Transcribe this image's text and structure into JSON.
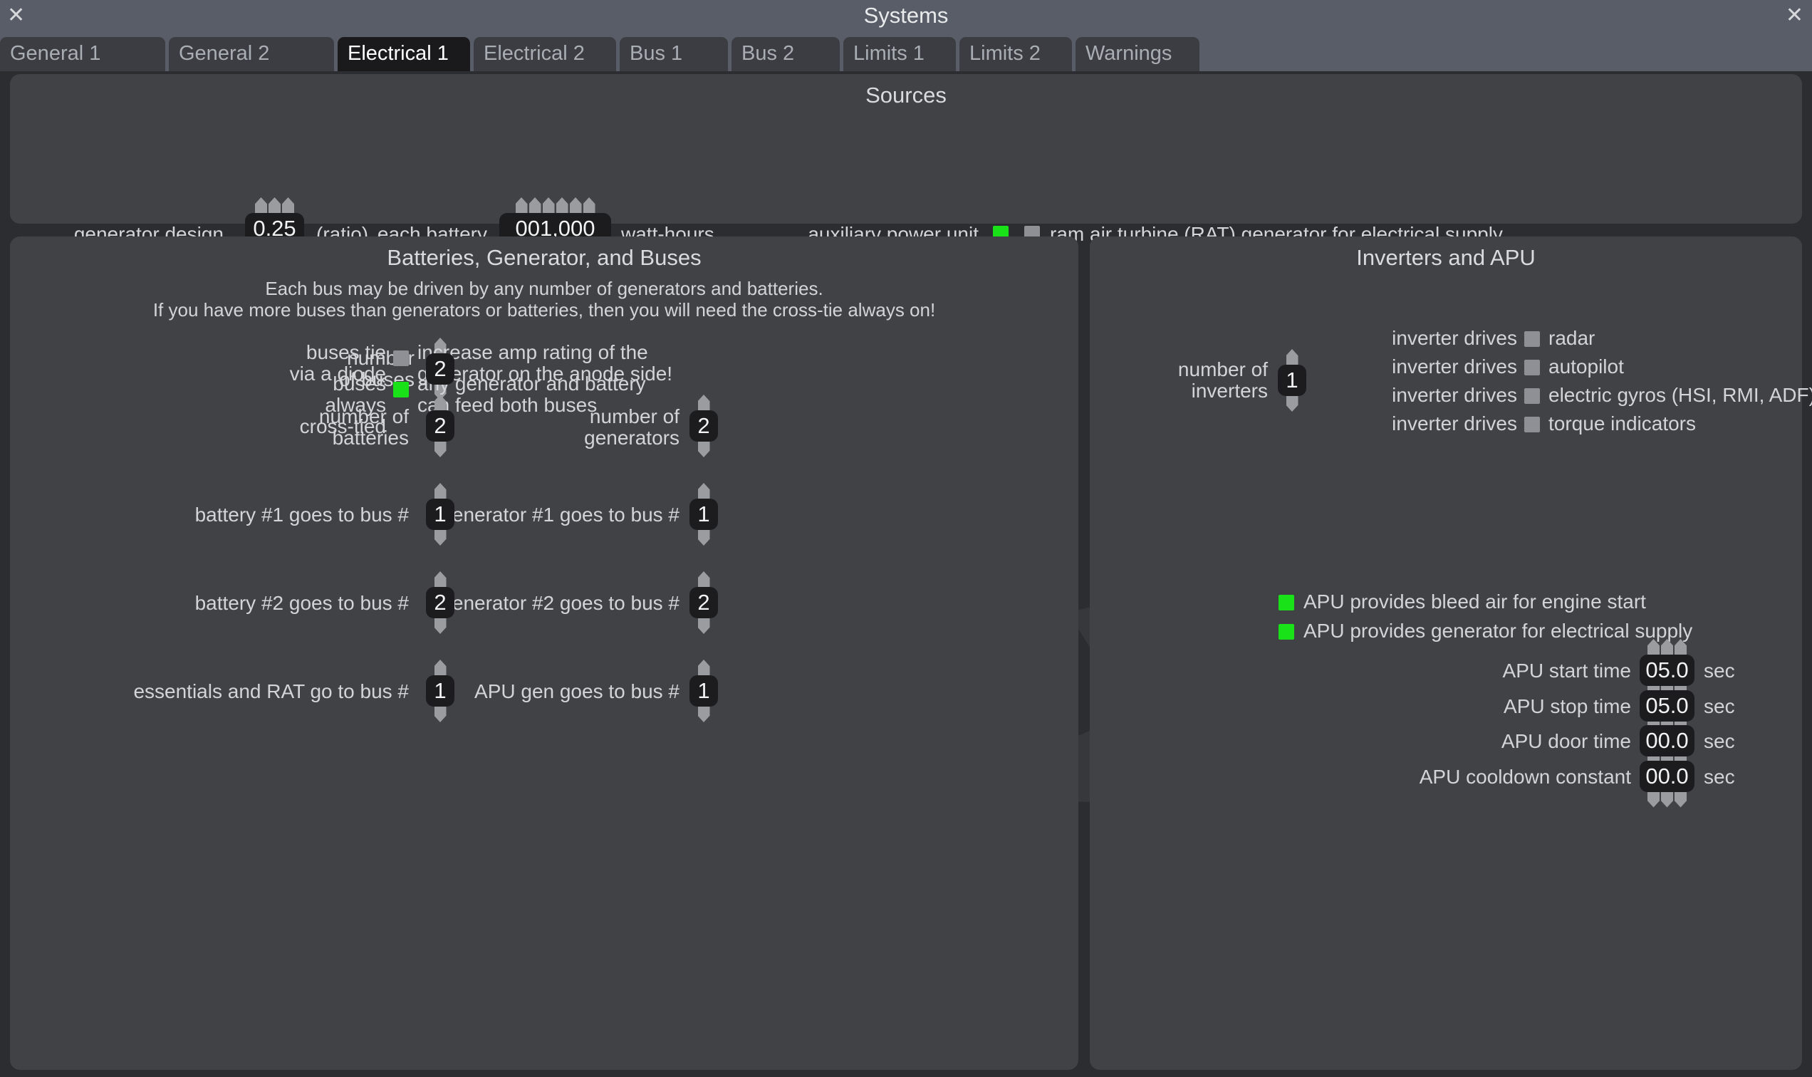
{
  "window": {
    "title": "Systems",
    "close_icon": "✕"
  },
  "tabs": [
    {
      "label": "General 1",
      "active": false
    },
    {
      "label": "General 2",
      "active": false
    },
    {
      "label": "Electrical 1",
      "active": true
    },
    {
      "label": "Electrical 2",
      "active": false
    },
    {
      "label": "Bus 1",
      "active": false
    },
    {
      "label": "Bus 2",
      "active": false
    },
    {
      "label": "Limits 1",
      "active": false
    },
    {
      "label": "Limits 2",
      "active": false
    },
    {
      "label": "Warnings",
      "active": false
    }
  ],
  "sources": {
    "title": "Sources",
    "generator_rpm_label": "generator design RPM",
    "generator_rpm_value": "0.25",
    "generator_rpm_unit": "(ratio)",
    "battery_label": "each battery",
    "battery_value": "001,000",
    "battery_unit": "watt-hours",
    "apu_label": "auxiliary power unit (APU)",
    "apu_checked": true,
    "rat_label": "ram air turbine (RAT) generator for electrical supply",
    "rat_checked": false
  },
  "batteries_panel": {
    "title": "Batteries, Generator, and Buses",
    "subtitle_line1": "Each bus may be driven by any number of generators and batteries.",
    "subtitle_line2": "If you have more buses than generators or batteries, then you will need the cross-tie always on!",
    "num_buses_label": "number\nof buses",
    "num_buses_value": "2",
    "diode_label": "buses tie\nvia a diode",
    "diode_checked": false,
    "diode_desc": "increase amp rating of the\ngenerator on the anode side!",
    "crosstie_label": "buses always\ncross-tied",
    "crosstie_checked": true,
    "crosstie_desc": "any generator and battery\ncan feed both buses",
    "left_rows": [
      {
        "label": "number of\nbatteries",
        "value": "2"
      },
      {
        "label": "battery #1 goes to bus #",
        "value": "1"
      },
      {
        "label": "battery #2 goes to bus #",
        "value": "2"
      },
      {
        "label": "essentials and RAT go to bus #",
        "value": "1"
      }
    ],
    "right_rows": [
      {
        "label": "number of\ngenerators",
        "value": "2"
      },
      {
        "label": "generator #1 goes to bus #",
        "value": "1"
      },
      {
        "label": "generator #2 goes to bus #",
        "value": "2"
      },
      {
        "label": "APU gen goes to bus #",
        "value": "1"
      }
    ]
  },
  "inverters_panel": {
    "title": "Inverters and APU",
    "num_inverters_label": "number of\ninverters",
    "num_inverters_value": "1",
    "inverter_rows": [
      {
        "prefix": "inverter drives",
        "checked": false,
        "label": "radar"
      },
      {
        "prefix": "inverter drives",
        "checked": false,
        "label": "autopilot"
      },
      {
        "prefix": "inverter drives",
        "checked": false,
        "label": "electric gyros (HSI, RMI, ADF)"
      },
      {
        "prefix": "inverter drives",
        "checked": false,
        "label": "torque indicators"
      }
    ],
    "apu_options": [
      {
        "checked": true,
        "label": "APU provides bleed air for engine start"
      },
      {
        "checked": true,
        "label": "APU provides generator for electrical supply"
      }
    ],
    "apu_times": [
      {
        "label": "APU start time",
        "value": "05.0",
        "unit": "sec"
      },
      {
        "label": "APU stop time",
        "value": "05.0",
        "unit": "sec"
      },
      {
        "label": "APU door time",
        "value": "00.0",
        "unit": "sec"
      },
      {
        "label": "APU cooldown constant",
        "value": "00.0",
        "unit": "sec"
      }
    ]
  },
  "colors": {
    "checkbox_on": "#19e219",
    "checkbox_off": "#8e9095",
    "panel_bg": "#414246",
    "titlebar_bg": "#585d68",
    "tab_active_bg": "#1a1a1c",
    "spin_value_bg": "#1c1c1e"
  }
}
